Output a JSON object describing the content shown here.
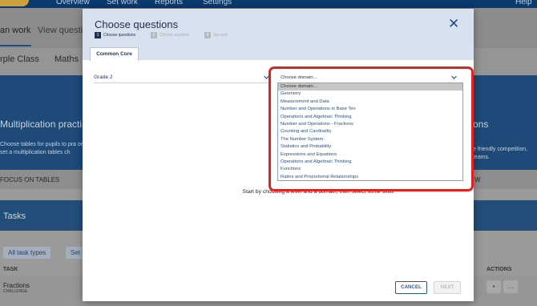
{
  "background": {
    "nav": [
      "Overview",
      "Set work",
      "Reports",
      "Settings",
      "Help"
    ],
    "tabs": [
      "an work",
      "View questio"
    ],
    "filters": [
      "rple Class",
      "Maths"
    ],
    "hero_title": "Multiplication practi",
    "hero_desc": "Choose tables for pupils to pra or set a multiplication tables ch",
    "hero_right_title": "ons",
    "hero_right_desc": "e friendly competition, teams.",
    "focus_label": "FOCUS ON TABLES",
    "focus_right": "W",
    "tasks_title": "Tasks",
    "task_filters": [
      "All task types",
      "Set t"
    ],
    "col_task": "TASK",
    "col_actions": "ACTIONS",
    "task_name": "Fractions",
    "task_type": "CHALLENGE"
  },
  "modal": {
    "title": "Choose questions",
    "close_icon": "close-icon",
    "steps": [
      {
        "num": "1",
        "label": "Choose questions"
      },
      {
        "num": "2",
        "label": "Choose students"
      },
      {
        "num": "3",
        "label": "Set task"
      }
    ],
    "tab_label": "Common Core",
    "grade_value": "Grade 2",
    "domain_value": "Choose domain...",
    "domain_options": [
      "Choose domain...",
      "Geometry",
      "Measurement and Data",
      "Number and Operations in Base Ten",
      "Operations and Algebraic Thinking",
      "Number and Operations - Fractions",
      "Counting and Cardinality",
      "The Number System",
      "Statistics and Probability",
      "Expressions and Equations",
      "Operations and Algebraic Thinking",
      "Functions",
      "Ratios and Proportional Relationships"
    ],
    "hint": "Start by choosing a level and a domain, then select some skills",
    "cancel_label": "CANCEL",
    "next_label": "NEXT"
  },
  "colors": {
    "accent": "#1d4f86",
    "highlight": "#e0231f"
  }
}
